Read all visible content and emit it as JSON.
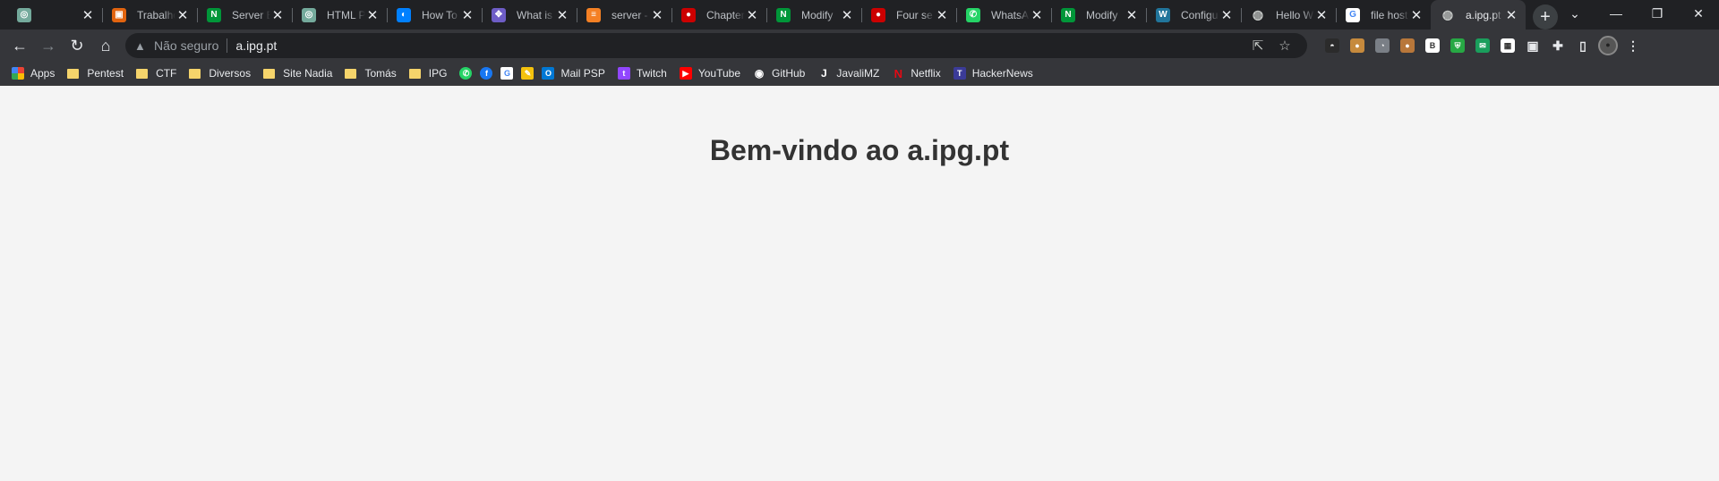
{
  "tabs": [
    {
      "title": "",
      "icon": "chatgpt-icon",
      "color": "#74aa9c",
      "glyph": "◎"
    },
    {
      "title": "Trabalho",
      "icon": "ticket-icon",
      "color": "#e2640f",
      "glyph": "▣"
    },
    {
      "title": "Server B",
      "icon": "nginx-icon",
      "color": "#009639",
      "glyph": "N"
    },
    {
      "title": "HTML P",
      "icon": "chatgpt-icon",
      "color": "#74aa9c",
      "glyph": "◎"
    },
    {
      "title": "How To",
      "icon": "digitalocean-icon",
      "color": "#0080ff",
      "glyph": "◐"
    },
    {
      "title": "What is",
      "icon": "slack-icon",
      "color": "#6e5dc6",
      "glyph": "✥"
    },
    {
      "title": "server -",
      "icon": "stackoverflow-icon",
      "color": "#f48024",
      "glyph": "≡"
    },
    {
      "title": "Chapter",
      "icon": "redhat-icon",
      "color": "#cc0000",
      "glyph": "●"
    },
    {
      "title": "Modify",
      "icon": "nginx-icon",
      "color": "#009639",
      "glyph": "N"
    },
    {
      "title": "Four se",
      "icon": "redhat-icon",
      "color": "#cc0000",
      "glyph": "●"
    },
    {
      "title": "WhatsA",
      "icon": "whatsapp-icon",
      "color": "#25d366",
      "glyph": "✆"
    },
    {
      "title": "Modify",
      "icon": "nginx-icon",
      "color": "#009639",
      "glyph": "N"
    },
    {
      "title": "Configu",
      "icon": "wordpress-icon",
      "color": "#21759b",
      "glyph": "W"
    },
    {
      "title": "Hello W",
      "icon": "globe-icon",
      "color": "#5f6368",
      "glyph": "◍"
    },
    {
      "title": "file host",
      "icon": "google-icon",
      "color": "#ffffff",
      "glyph": "G"
    },
    {
      "title": "a.ipg.pt",
      "icon": "globe-icon",
      "color": "#5f6368",
      "glyph": "◍",
      "active": true
    }
  ],
  "address": {
    "security_label": "Não seguro",
    "url": "a.ipg.pt"
  },
  "extensions": [
    {
      "icon": "hat-extension-icon",
      "color": "#2b2b2b"
    },
    {
      "icon": "cookie-extension-icon",
      "color": "#c68a3d"
    },
    {
      "icon": "gauge-extension-icon",
      "color": "#7a7f86"
    },
    {
      "icon": "cookie2-extension-icon",
      "color": "#b8773a"
    },
    {
      "icon": "b-extension-icon",
      "color": "#ffffff"
    },
    {
      "icon": "shield-extension-icon",
      "color": "#27a844"
    },
    {
      "icon": "mail-extension-icon",
      "color": "#1a9e5c"
    },
    {
      "icon": "calendar-extension-icon",
      "color": "#ffffff"
    },
    {
      "icon": "tabs-extension-icon",
      "color": "#e8eaed"
    },
    {
      "icon": "puzzle-extension-icon",
      "color": "#e8eaed"
    },
    {
      "icon": "sidepanel-icon",
      "color": "#e8eaed"
    },
    {
      "icon": "avatar-icon",
      "color": "#888888"
    },
    {
      "icon": "menu-kebab-icon",
      "color": "#e8eaed"
    }
  ],
  "bookmarks": [
    {
      "label": "Apps",
      "type": "apps"
    },
    {
      "label": "Pentest",
      "type": "folder"
    },
    {
      "label": "CTF",
      "type": "folder"
    },
    {
      "label": "Diversos",
      "type": "folder"
    },
    {
      "label": "Site Nadia",
      "type": "folder"
    },
    {
      "label": "Tomás",
      "type": "folder"
    },
    {
      "label": "IPG",
      "type": "folder"
    }
  ],
  "bookmark_icons": [
    {
      "icon": "whatsapp-icon",
      "color": "#25d366",
      "glyph": "✆"
    },
    {
      "icon": "facebook-icon",
      "color": "#1877f2",
      "glyph": "f"
    },
    {
      "icon": "google-icon",
      "color": "#ffffff",
      "glyph": "G"
    },
    {
      "icon": "pencil-icon",
      "color": "#f4c20d",
      "glyph": "✎"
    }
  ],
  "bookmarks2": [
    {
      "label": "Mail PSP",
      "icon": "outlook-icon",
      "color": "#0078d4",
      "glyph": "O"
    },
    {
      "label": "Twitch",
      "icon": "twitch-icon",
      "color": "#9146ff",
      "glyph": "t"
    },
    {
      "label": "YouTube",
      "icon": "youtube-icon",
      "color": "#ff0000",
      "glyph": "▶"
    },
    {
      "label": "GitHub",
      "icon": "github-icon",
      "color": "#ffffff",
      "glyph": "◉"
    },
    {
      "label": "JavaliMZ",
      "icon": "javali-icon",
      "color": "#ffffff",
      "glyph": "J"
    },
    {
      "label": "Netflix",
      "icon": "netflix-icon",
      "color": "#e50914",
      "glyph": "N"
    },
    {
      "label": "HackerNews",
      "icon": "hackernews-icon",
      "color": "#3b3b98",
      "glyph": "T"
    }
  ],
  "page": {
    "heading": "Bem-vindo ao a.ipg.pt"
  }
}
